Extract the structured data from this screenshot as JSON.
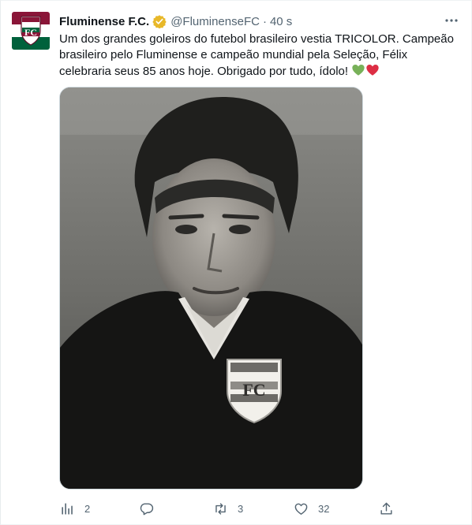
{
  "tweet": {
    "display_name": "Fluminense F.C.",
    "handle": "@FluminenseFC",
    "separator": "·",
    "time": "40 s",
    "text": "Um dos grandes goleiros do futebol brasileiro vestia TRICOLOR. Campeão brasileiro pelo Fluminense e campeão mundial pela Seleção, Félix celebraria seus 85 anos hoje. Obrigado por tudo, ídolo!",
    "emojis": [
      "green-heart-icon",
      "red-heart-icon"
    ]
  },
  "stats": {
    "views": "2",
    "replies": "",
    "retweets": "3",
    "likes": "32"
  },
  "colors": {
    "verified": "#e8b829",
    "text": "#0f1419",
    "muted": "#536471",
    "fluminense_maroon": "#8a1538",
    "fluminense_green": "#00613c"
  }
}
